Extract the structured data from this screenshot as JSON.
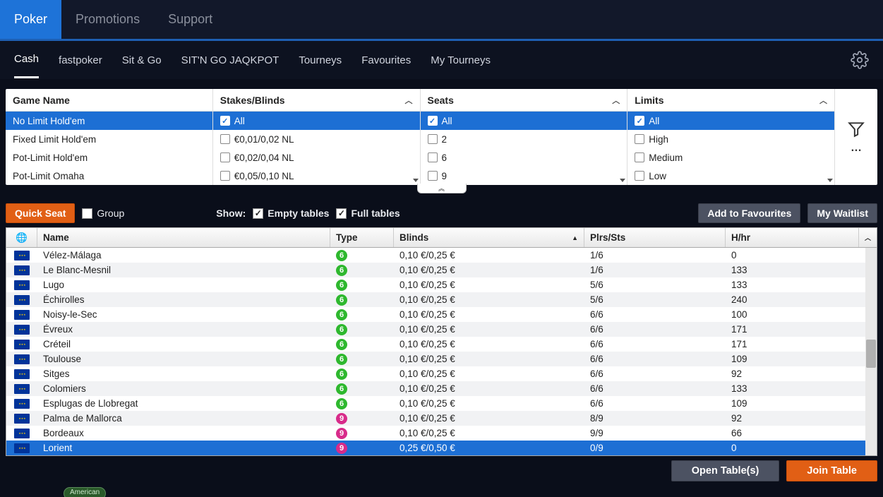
{
  "topnav": {
    "tabs": [
      {
        "label": "Poker",
        "active": true
      },
      {
        "label": "Promotions",
        "active": false
      },
      {
        "label": "Support",
        "active": false
      }
    ]
  },
  "subnav": {
    "tabs": [
      {
        "label": "Cash",
        "active": true
      },
      {
        "label": "fastpoker",
        "active": false
      },
      {
        "label": "Sit & Go",
        "active": false
      },
      {
        "label": "SIT'N GO JAQKPOT",
        "active": false
      },
      {
        "label": "Tourneys",
        "active": false
      },
      {
        "label": "Favourites",
        "active": false
      },
      {
        "label": "My Tourneys",
        "active": false
      }
    ]
  },
  "filters": {
    "gameName": {
      "header": "Game Name",
      "items": [
        {
          "label": "No Limit Hold'em",
          "selected": true
        },
        {
          "label": "Fixed Limit Hold'em",
          "selected": false
        },
        {
          "label": "Pot-Limit Hold'em",
          "selected": false
        },
        {
          "label": "Pot-Limit Omaha",
          "selected": false
        }
      ]
    },
    "stakes": {
      "header": "Stakes/Blinds",
      "items": [
        {
          "label": "All",
          "selected": true
        },
        {
          "label": "€0,01/0,02 NL",
          "selected": false
        },
        {
          "label": "€0,02/0,04 NL",
          "selected": false
        },
        {
          "label": "€0,05/0,10 NL",
          "selected": false
        }
      ]
    },
    "seats": {
      "header": "Seats",
      "items": [
        {
          "label": "All",
          "selected": true
        },
        {
          "label": "2",
          "selected": false
        },
        {
          "label": "6",
          "selected": false
        },
        {
          "label": "9",
          "selected": false
        }
      ]
    },
    "limits": {
      "header": "Limits",
      "items": [
        {
          "label": "All",
          "selected": true
        },
        {
          "label": "High",
          "selected": false
        },
        {
          "label": "Medium",
          "selected": false
        },
        {
          "label": "Low",
          "selected": false
        }
      ]
    }
  },
  "toolbar": {
    "quickSeat": "Quick Seat",
    "group": "Group",
    "showLabel": "Show:",
    "emptyTables": "Empty tables",
    "fullTables": "Full tables",
    "addFav": "Add to Favourites",
    "waitlist": "My Waitlist"
  },
  "table": {
    "cols": {
      "name": "Name",
      "type": "Type",
      "blinds": "Blinds",
      "plrs": "Plrs/Sts",
      "hhr": "H/hr"
    },
    "sortCol": "blinds",
    "rows": [
      {
        "name": "Vélez-Málaga",
        "type": "6",
        "blinds": "0,10 €/0,25 €",
        "plrs": "1/6",
        "hhr": "0"
      },
      {
        "name": "Le Blanc-Mesnil",
        "type": "6",
        "blinds": "0,10 €/0,25 €",
        "plrs": "1/6",
        "hhr": "133"
      },
      {
        "name": "Lugo",
        "type": "6",
        "blinds": "0,10 €/0,25 €",
        "plrs": "5/6",
        "hhr": "133"
      },
      {
        "name": "Échirolles",
        "type": "6",
        "blinds": "0,10 €/0,25 €",
        "plrs": "5/6",
        "hhr": "240"
      },
      {
        "name": "Noisy-le-Sec",
        "type": "6",
        "blinds": "0,10 €/0,25 €",
        "plrs": "6/6",
        "hhr": "100"
      },
      {
        "name": "Évreux",
        "type": "6",
        "blinds": "0,10 €/0,25 €",
        "plrs": "6/6",
        "hhr": "171"
      },
      {
        "name": "Créteil",
        "type": "6",
        "blinds": "0,10 €/0,25 €",
        "plrs": "6/6",
        "hhr": "171"
      },
      {
        "name": "Toulouse",
        "type": "6",
        "blinds": "0,10 €/0,25 €",
        "plrs": "6/6",
        "hhr": "109"
      },
      {
        "name": "Sitges",
        "type": "6",
        "blinds": "0,10 €/0,25 €",
        "plrs": "6/6",
        "hhr": "92"
      },
      {
        "name": "Colomiers",
        "type": "6",
        "blinds": "0,10 €/0,25 €",
        "plrs": "6/6",
        "hhr": "133"
      },
      {
        "name": "Esplugas de Llobregat",
        "type": "6",
        "blinds": "0,10 €/0,25 €",
        "plrs": "6/6",
        "hhr": "109"
      },
      {
        "name": "Palma de Mallorca",
        "type": "9",
        "blinds": "0,10 €/0,25 €",
        "plrs": "8/9",
        "hhr": "92"
      },
      {
        "name": "Bordeaux",
        "type": "9",
        "blinds": "0,10 €/0,25 €",
        "plrs": "9/9",
        "hhr": "66"
      },
      {
        "name": "Lorient",
        "type": "9",
        "blinds": "0,25 €/0,50 €",
        "plrs": "0/9",
        "hhr": "0",
        "selected": true
      }
    ]
  },
  "bottom": {
    "open": "Open Table(s)",
    "join": "Join Table"
  },
  "footer": {
    "pill": "American"
  }
}
